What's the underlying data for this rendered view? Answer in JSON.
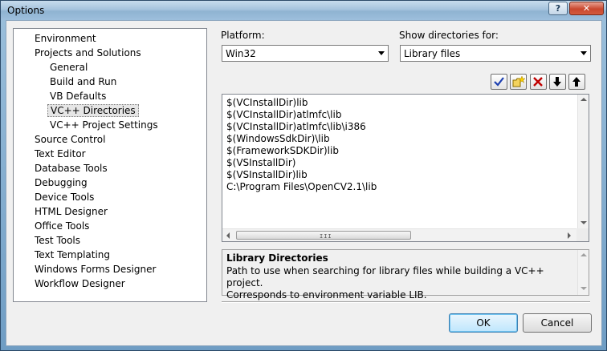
{
  "window": {
    "title": "Options",
    "help_label": "?",
    "close_label": "✕"
  },
  "tree": {
    "items": [
      {
        "label": "Environment",
        "level": 0
      },
      {
        "label": "Projects and Solutions",
        "level": 0
      },
      {
        "label": "General",
        "level": 1
      },
      {
        "label": "Build and Run",
        "level": 1
      },
      {
        "label": "VB Defaults",
        "level": 1
      },
      {
        "label": "VC++ Directories",
        "level": 1,
        "selected": true
      },
      {
        "label": "VC++ Project Settings",
        "level": 1
      },
      {
        "label": "Source Control",
        "level": 0
      },
      {
        "label": "Text Editor",
        "level": 0
      },
      {
        "label": "Database Tools",
        "level": 0
      },
      {
        "label": "Debugging",
        "level": 0
      },
      {
        "label": "Device Tools",
        "level": 0
      },
      {
        "label": "HTML Designer",
        "level": 0
      },
      {
        "label": "Office Tools",
        "level": 0
      },
      {
        "label": "Test Tools",
        "level": 0
      },
      {
        "label": "Text Templating",
        "level": 0
      },
      {
        "label": "Windows Forms Designer",
        "level": 0
      },
      {
        "label": "Workflow Designer",
        "level": 0
      }
    ]
  },
  "platform": {
    "label": "Platform:",
    "value": "Win32"
  },
  "show_dirs": {
    "label": "Show directories for:",
    "value": "Library files"
  },
  "toolbar": {
    "icons": [
      "checkmark-icon",
      "new-folder-icon",
      "delete-x-icon",
      "move-down-icon",
      "move-up-icon"
    ]
  },
  "directories": [
    "$(VCInstallDir)lib",
    "$(VCInstallDir)atlmfc\\lib",
    "$(VCInstallDir)atlmfc\\lib\\i386",
    "$(WindowsSdkDir)\\lib",
    "$(FrameworkSDKDir)lib",
    "$(VSInstallDir)",
    "$(VSInstallDir)lib",
    "C:\\Program Files\\OpenCV2.1\\lib"
  ],
  "description": {
    "title": "Library Directories",
    "line1": "Path to use when searching for library files while building a VC++ project.",
    "line2": "Corresponds to environment variable LIB."
  },
  "buttons": {
    "ok": "OK",
    "cancel": "Cancel"
  },
  "colors": {
    "selection_gray": "#e6e6e6",
    "delete_red": "#c00000",
    "check_blue": "#1c3fb0"
  }
}
